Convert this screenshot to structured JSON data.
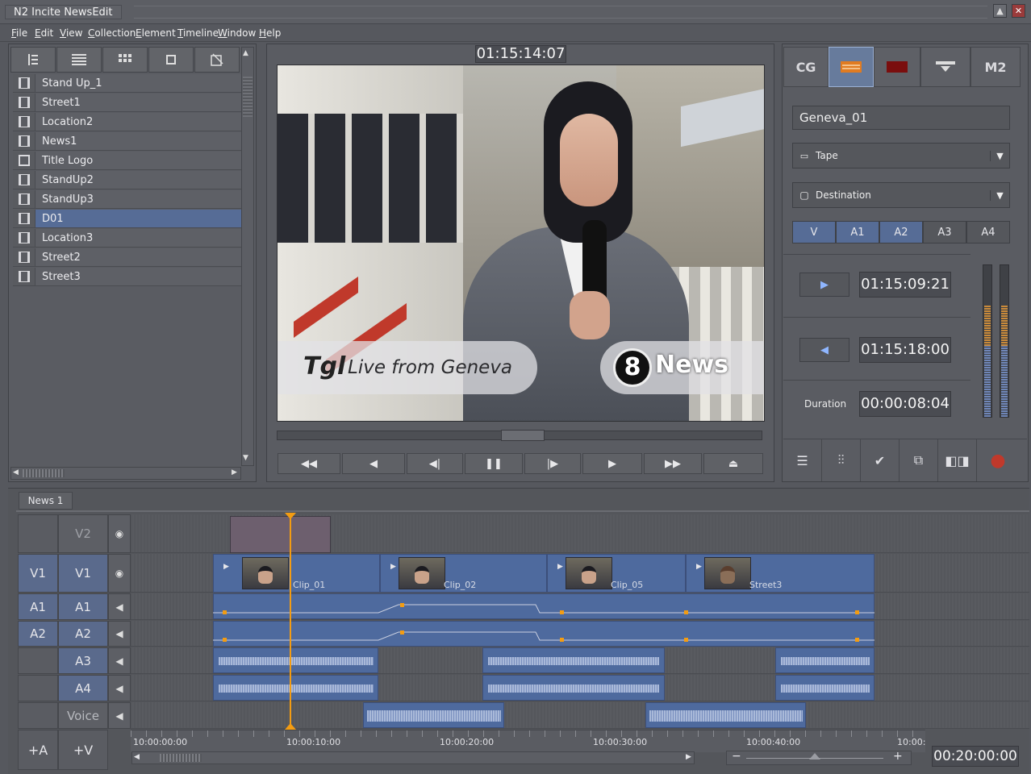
{
  "window": {
    "title": "N2 Incite NewsEdit"
  },
  "menu": [
    "File",
    "Edit",
    "View",
    "Collection",
    "Element",
    "Timeline",
    "Window",
    "Help"
  ],
  "bin": {
    "items": [
      {
        "label": "Stand Up_1",
        "icon": "film-icon"
      },
      {
        "label": "Street1",
        "icon": "film-icon"
      },
      {
        "label": "Location2",
        "icon": "film-icon"
      },
      {
        "label": "News1",
        "icon": "film-icon"
      },
      {
        "label": "Title Logo",
        "icon": "still-icon"
      },
      {
        "label": "StandUp2",
        "icon": "film-icon"
      },
      {
        "label": "StandUp3",
        "icon": "film-icon"
      },
      {
        "label": "D01",
        "icon": "film-icon",
        "selected": true
      },
      {
        "label": "Location3",
        "icon": "film-icon"
      },
      {
        "label": "Street2",
        "icon": "film-icon"
      },
      {
        "label": "Street3",
        "icon": "film-icon"
      }
    ]
  },
  "viewer": {
    "timecode": "01:15:14:07",
    "lower_third": "Live from Geneva",
    "logo_text": "Tgl",
    "news_logo": "News",
    "news_number": "8"
  },
  "transport": [
    "rewind",
    "prev",
    "step-back",
    "pause",
    "step-forward",
    "play",
    "fast-forward",
    "eject"
  ],
  "inspector": {
    "tabs": [
      "CG",
      "title",
      "color",
      "transition",
      "M2"
    ],
    "clip_name": "Geneva_01",
    "source": "Tape",
    "destination": "Destination",
    "tracks": [
      "V",
      "A1",
      "A2",
      "A3",
      "A4"
    ],
    "mark_in": "01:15:09:21",
    "mark_out": "01:15:18:00",
    "duration_label": "Duration",
    "duration": "00:00:08:04"
  },
  "timeline": {
    "tab": "News 1",
    "v2": "V2",
    "rows": [
      {
        "head": "V1",
        "name": "V1"
      },
      {
        "head": "A1",
        "name": "A1"
      },
      {
        "head": "A2",
        "name": "A2"
      },
      {
        "head": "",
        "name": "A3"
      },
      {
        "head": "",
        "name": "A4"
      },
      {
        "head": "",
        "name": "Voice"
      }
    ],
    "clips": [
      "Clip_01",
      "Clip_02",
      "Clip_05",
      "Street3"
    ],
    "ruler": [
      "10:00:00:00",
      "10:00:10:00",
      "10:00:20:00",
      "10:00:30:00",
      "10:00:40:00",
      "10:00:"
    ],
    "add_audio": "+A",
    "add_video": "+V",
    "total": "00:20:00:00"
  },
  "colors": {
    "accent": "#566c96",
    "clip": "#4e6a9e",
    "playhead": "#f39c12",
    "record": "#c0392b"
  }
}
